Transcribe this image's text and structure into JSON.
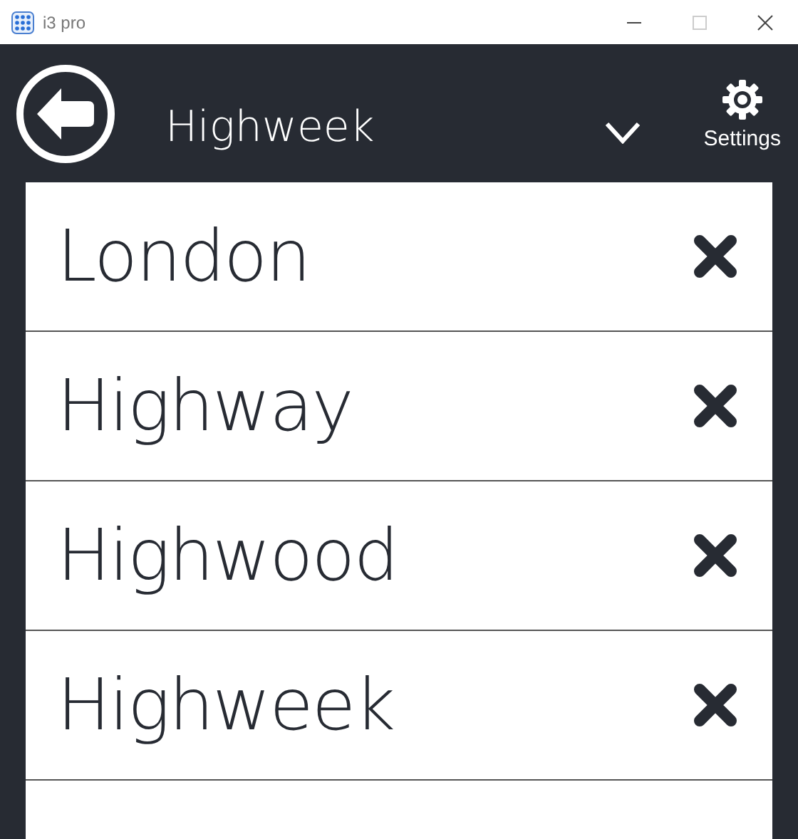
{
  "window": {
    "title": "i3 pro"
  },
  "header": {
    "title": "Highweek",
    "settings_label": "Settings"
  },
  "places": [
    {
      "name": "London"
    },
    {
      "name": "Highway"
    },
    {
      "name": "Highwood"
    },
    {
      "name": "Highweek"
    }
  ]
}
